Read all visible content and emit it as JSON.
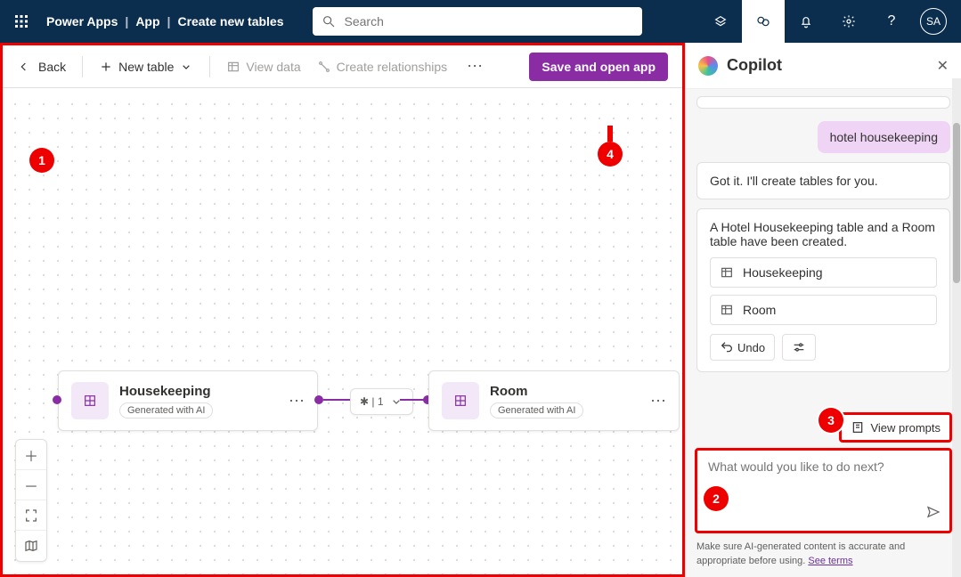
{
  "header": {
    "app_name": "Power Apps",
    "crumb_app": "App",
    "crumb_page": "Create new tables",
    "search_placeholder": "Search",
    "avatar_initials": "SA"
  },
  "toolbar": {
    "back_label": "Back",
    "new_table_label": "New table",
    "view_data_label": "View data",
    "create_rel_label": "Create relationships",
    "save_label": "Save and open app"
  },
  "cards": {
    "housekeeping": {
      "title": "Housekeeping",
      "badge": "Generated with AI"
    },
    "room": {
      "title": "Room",
      "badge": "Generated with AI"
    },
    "relation_label": "* | 1"
  },
  "copilot": {
    "title": "Copilot",
    "user_msg": "hotel housekeeping",
    "ai_msg1": "Got it. I'll create tables for you.",
    "ai_msg2": "A Hotel Housekeeping table and a Room table have been created.",
    "tables": [
      "Housekeeping",
      "Room"
    ],
    "undo_label": "Undo",
    "view_prompts_label": "View prompts",
    "compose_placeholder": "What would you like to do next?",
    "footnote_text": "Make sure AI-generated content is accurate and appropriate before using. ",
    "footnote_link": "See terms"
  },
  "annotations": {
    "a1": "1",
    "a2": "2",
    "a3": "3",
    "a4": "4"
  }
}
